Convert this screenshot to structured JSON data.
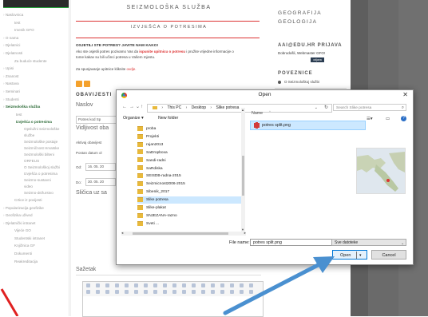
{
  "sidebar": {
    "items": [
      {
        "label": "Naslovnica",
        "level": "l1"
      },
      {
        "label": "test",
        "level": "plain"
      },
      {
        "label": "Imenik GFO",
        "level": "plain"
      },
      {
        "label": "O nama",
        "level": "l1"
      },
      {
        "label": "Djelatnici",
        "level": "l1"
      },
      {
        "label": "Djelatnosti",
        "level": "l1"
      },
      {
        "label": "Za buduće studente",
        "level": "plain"
      },
      {
        "label": "Upisi",
        "level": "l1"
      },
      {
        "label": "Znanost",
        "level": "l1"
      },
      {
        "label": "Nastava",
        "level": "l1"
      },
      {
        "label": "Seminari",
        "level": "l1"
      },
      {
        "label": "Studenti",
        "level": "l1"
      },
      {
        "label": "Seizmološka služba",
        "level": "l1 active"
      },
      {
        "label": "test",
        "level": "l2"
      },
      {
        "label": "Izvješća o potresima",
        "level": "l2 active"
      },
      {
        "label": "Opslužni seizmološke",
        "level": "l3"
      },
      {
        "label": "službe",
        "level": "l3"
      },
      {
        "label": "Seizmološke postaje",
        "level": "l3"
      },
      {
        "label": "Seizmičnost Hrvatske",
        "level": "l3"
      },
      {
        "label": "Seizmološki bilteni",
        "level": "l3"
      },
      {
        "label": "ORFEUS",
        "level": "l3"
      },
      {
        "label": "O Seizmološkoj službi",
        "level": "l3"
      },
      {
        "label": "Izvješća o potresima",
        "level": "l3"
      },
      {
        "label": "Seizmo-sustavni",
        "level": "l3"
      },
      {
        "label": "video",
        "level": "l3"
      },
      {
        "label": "Seizmo-dežurstvo",
        "level": "l3"
      },
      {
        "label": "Crtice iz povijesti",
        "level": "plain"
      },
      {
        "label": "Popularizacija geofizike",
        "level": "l1"
      },
      {
        "label": "Geofizika užived",
        "level": "l1"
      },
      {
        "label": "Djelatnički intranet",
        "level": "l1"
      },
      {
        "label": "Vijeće GO",
        "level": "plain"
      },
      {
        "label": "Studentski intranet",
        "level": "plain"
      },
      {
        "label": "Knjižnica GF",
        "level": "plain"
      },
      {
        "label": "Dokumenti",
        "level": "plain"
      },
      {
        "label": "Reakreditacija",
        "level": "plain"
      }
    ]
  },
  "main": {
    "dept_title": "SEIZMOLOŠKA SLUŽBA",
    "subtitle": "IZVJEŠĆA O POTRESIMA",
    "intro_head": "OSJETILI STE POTRES? JAVITE NAM KAKO!",
    "intro_p1_a": "Ako ste osjetili potres pozivamo Vas da ",
    "intro_p1_red": "ispunite upitnicu o potresu",
    "intro_p1_b": " i pružite vrijedne informacije o",
    "intro_p2": "tome kakav su bili učinci potresa u Vašem mjestu.",
    "instr_a": "Za spunjavanje upitnice kliknite ",
    "instr_red": "ovdje.",
    "obav_head": "OBAVIJESTI",
    "naslov_label": "Naslov",
    "naslov_value": "Potres kod Sp",
    "vidljivost_label": "Vidljivost oba",
    "aktivaj_text": "Aktivaj obavijest",
    "postan_text": "Postan datum ol",
    "od_label": "Od:",
    "od_value": "16. 05. 20",
    "do_label": "Do:",
    "do_value": "30. 05. 20",
    "slicica_label": "Sličica uz sa",
    "sazetak_label": "Sažetak"
  },
  "right": {
    "hd1": "GEOGRAFIJA",
    "hd2": "GEOLOGIJA",
    "login_title": "AAI@EDU.HR PRIJAVA",
    "welcome": "Dobrodošli, Webmaster GFO!",
    "logout": "odjava",
    "links_title": "POVEZNICE",
    "link1": "O Seizmološkoj službi"
  },
  "dialog": {
    "title": "Open",
    "close": "✕",
    "nav_back": "←",
    "nav_fwd": "→",
    "nav_recent": "⌄",
    "nav_up": "↑",
    "crumbs": [
      "This PC",
      "Desktop",
      "Slike potresa"
    ],
    "crumb_sep": "›",
    "addr_dropdown": "⌄",
    "addr_refresh": "↻",
    "search_placeholder": "Search Slike potresa",
    "search_icon": "⌕",
    "organize": "Organize ▾",
    "new_folder": "New folder",
    "help": "?",
    "folders": [
      "proba",
      "Projekti",
      "rujan2013",
      "SaDropboxa",
      "Sandi-radni",
      "SaRdiska",
      "SEISDB-radna-2015",
      "Seizmicnost2006-2015",
      "Sibenik_2017",
      "Slike potresa",
      "Slike-plakat",
      "SNJEZANA-razno",
      "Sveti ..."
    ],
    "selected_folder": "Slike potresa",
    "col_name": "Name",
    "file_name": "potres split.png",
    "filename_label": "File name:",
    "filename_value": "potres split.png",
    "filetype": "Sve datoteke",
    "open_label": "Open",
    "open_dropdown": "▾",
    "cancel_label": "Cancel"
  },
  "colors": {
    "accent_red": "#d33333",
    "sidebar_active": "#2d6b38",
    "dialog_selection": "#cce8ff",
    "open_button_border": "#0078d7",
    "annotation_arrow": "#4a90d0",
    "annotation_red": "#e02020"
  }
}
